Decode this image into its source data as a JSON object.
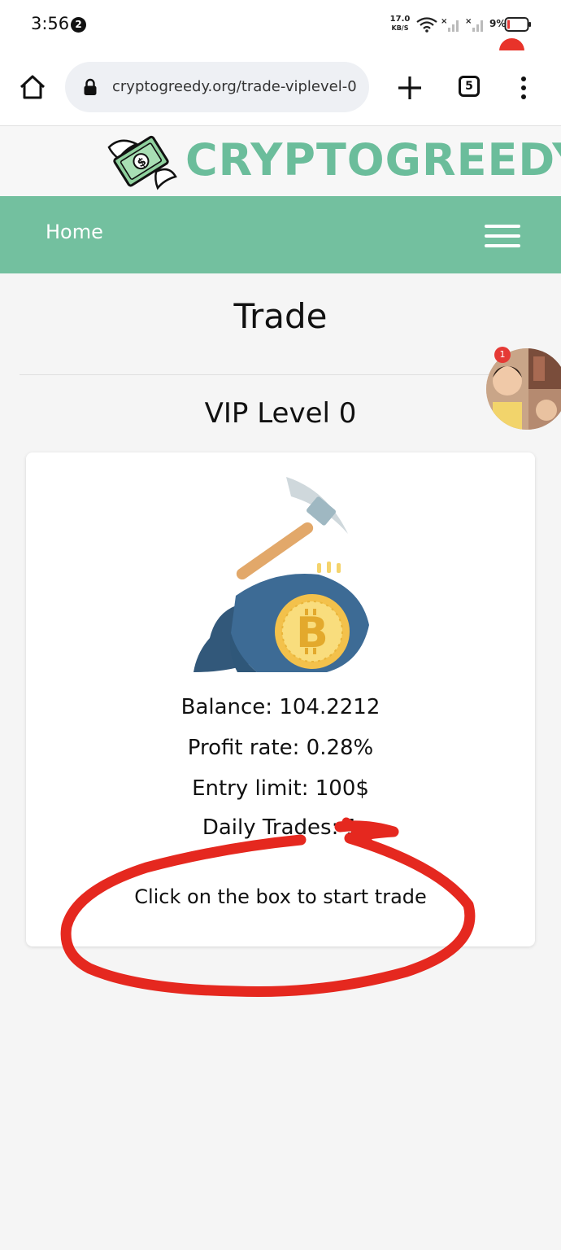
{
  "status_bar": {
    "time": "3:56",
    "notification_count": "2",
    "net_speed_value": "17.0",
    "net_speed_unit": "KB/S",
    "battery": "9%"
  },
  "browser": {
    "url": "cryptogreedy.org/trade-viplevel-0",
    "tab_count": "5"
  },
  "site": {
    "logo_text": "CRYPTOGREEDY",
    "nav_home": "Home",
    "brand_color": "#73c09f"
  },
  "page": {
    "title": "Trade",
    "level": "VIP Level 0"
  },
  "chat": {
    "badge": "1"
  },
  "card": {
    "balance": "Balance: 104.2212",
    "profit_rate": "Profit rate: 0.28%",
    "entry_limit": "Entry limit: 100$",
    "daily_trades": "Daily Trades: 1",
    "start_hint": "Click on the box to start trade"
  },
  "icons": {
    "home": "home-icon",
    "lock": "lock-icon",
    "new_tab": "plus-icon",
    "menu": "kebab-icon",
    "nav_menu": "hamburger-icon",
    "illustration": "bitcoin-mining-icon"
  },
  "annotation_color": "#e5281f"
}
